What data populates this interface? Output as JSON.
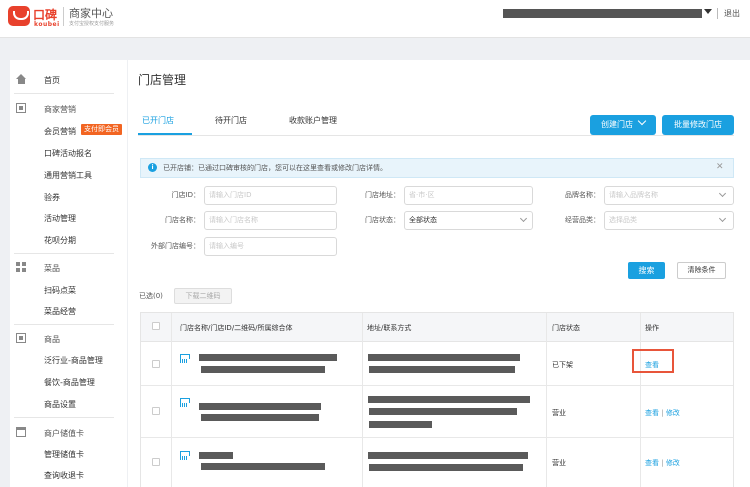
{
  "header": {
    "logo_cn": "口碑",
    "logo_en": "koubei",
    "brand_title": "商家中心",
    "brand_subtitle": "支付宝授权支付服务",
    "logout": "退出"
  },
  "sidebar": {
    "home": "首页",
    "groups": [
      {
        "label": "商家营销",
        "items": [
          "会员营销",
          "口碑活动报名",
          "通用营销工具",
          "验券",
          "活动管理",
          "花呗分期"
        ],
        "badge": "支付即会员"
      },
      {
        "label": "菜品",
        "items": [
          "扫码点菜",
          "菜品经营"
        ]
      },
      {
        "label": "商品",
        "items": [
          "泛行业-商品管理",
          "餐饮-商品管理",
          "商品设置"
        ]
      },
      {
        "label": "商户储值卡",
        "items": [
          "管理储值卡",
          "查询收退卡"
        ]
      }
    ]
  },
  "main": {
    "title": "门店管理",
    "tabs": [
      "已开门店",
      "待开门店",
      "收款账户管理"
    ],
    "create_store": "创建门店",
    "batch_edit": "批量修改门店",
    "info": "已开店铺：已通过口碑审核的门店，您可以在这里查看或修改门店详情。",
    "filters": {
      "store_id": {
        "label": "门店ID：",
        "placeholder": "请输入门店ID"
      },
      "store_name": {
        "label": "门店名称：",
        "placeholder": "请输入门店名称"
      },
      "external_id": {
        "label": "外部门店编号：",
        "placeholder": "请输入编号"
      },
      "address": {
        "label": "门店地址：",
        "placeholder": "省·市·区"
      },
      "status": {
        "label": "门店状态：",
        "value": "全部状态"
      },
      "brand": {
        "label": "品牌名称：",
        "placeholder": "请输入品牌名称"
      },
      "category": {
        "label": "经营品类：",
        "placeholder": "选择品类"
      }
    },
    "search": "搜索",
    "clear": "清除条件",
    "selected": "已选(0)",
    "download_qr": "下载二维码",
    "table": {
      "headers": [
        "门店名称/门店ID/二维码/所属综合体",
        "地址/联系方式",
        "门店状态",
        "操作"
      ],
      "rows": [
        {
          "status": "已下架",
          "view": "查看",
          "edit": ""
        },
        {
          "status": "营业",
          "view": "查看",
          "edit": "修改"
        },
        {
          "status": "营业",
          "view": "查看",
          "edit": "修改"
        }
      ]
    }
  }
}
